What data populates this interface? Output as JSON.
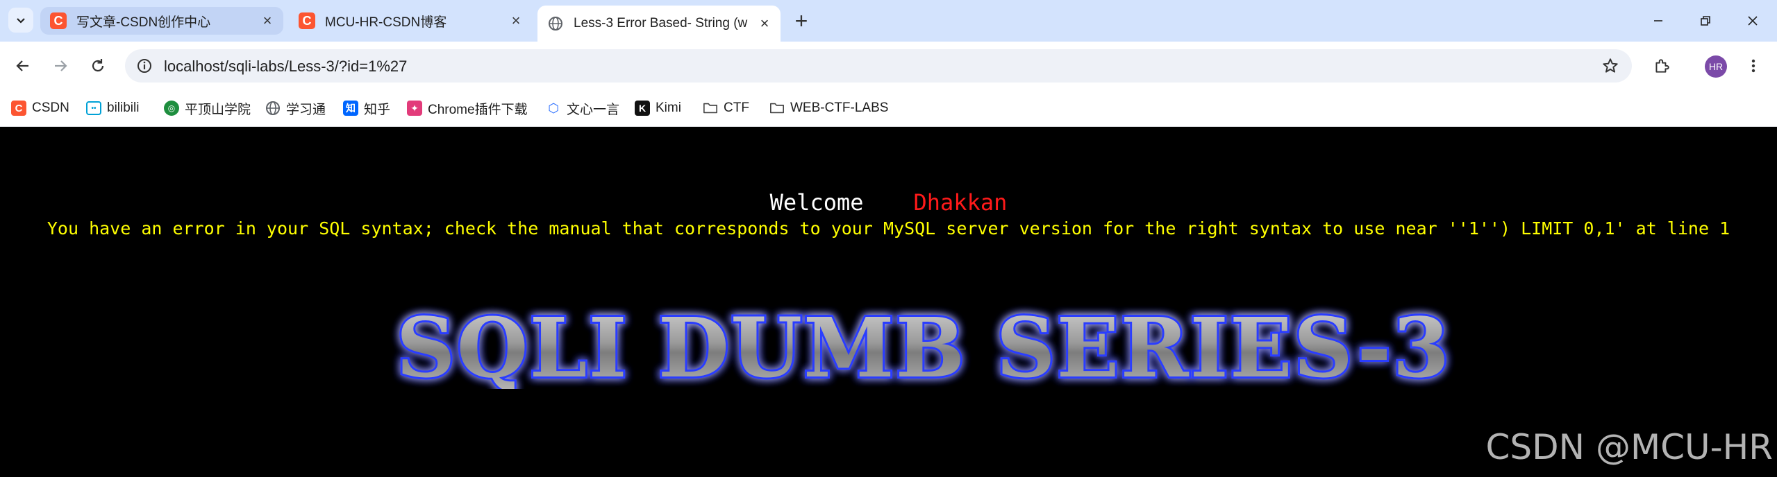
{
  "tabs": [
    {
      "title": "写文章-CSDN创作中心",
      "favicon": "csdn-icon",
      "active": false
    },
    {
      "title": "MCU-HR-CSDN博客",
      "favicon": "csdn-icon",
      "active": false
    },
    {
      "title": "Less-3 Error Based- String (w",
      "favicon": "globe-icon",
      "active": true
    }
  ],
  "address_bar": {
    "url": "localhost/sqli-labs/Less-3/?id=1%27"
  },
  "profile": {
    "initials": "HR",
    "color": "#7b4aa8"
  },
  "bookmarks": [
    {
      "label": "CSDN",
      "icon": "csdn-icon"
    },
    {
      "label": "bilibili",
      "icon": "bilibili-icon"
    },
    {
      "label": "平顶山学院",
      "icon": "school-icon"
    },
    {
      "label": "学习通",
      "icon": "globe-icon"
    },
    {
      "label": "知乎",
      "icon": "zhihu-icon"
    },
    {
      "label": "Chrome插件下载",
      "icon": "puzzle-icon"
    },
    {
      "label": "文心一言",
      "icon": "ernie-icon"
    },
    {
      "label": "Kimi",
      "icon": "kimi-icon"
    },
    {
      "label": "CTF",
      "icon": "folder-icon"
    },
    {
      "label": "WEB-CTF-LABS",
      "icon": "folder-icon"
    }
  ],
  "page": {
    "welcome": "Welcome",
    "username": "Dhakkan",
    "error": "You have an error in your SQL syntax; check the manual that corresponds to your MySQL server version for the right syntax to use near ''1'') LIMIT 0,1' at line 1",
    "banner": "SQLI DUMB SERIES-3"
  },
  "watermark": "CSDN @MCU-HR",
  "colors": {
    "accent": "#d3e3fd",
    "error_text": "#ffff00",
    "username": "#ff1a1a",
    "banner_glow": "#2a3cff"
  }
}
